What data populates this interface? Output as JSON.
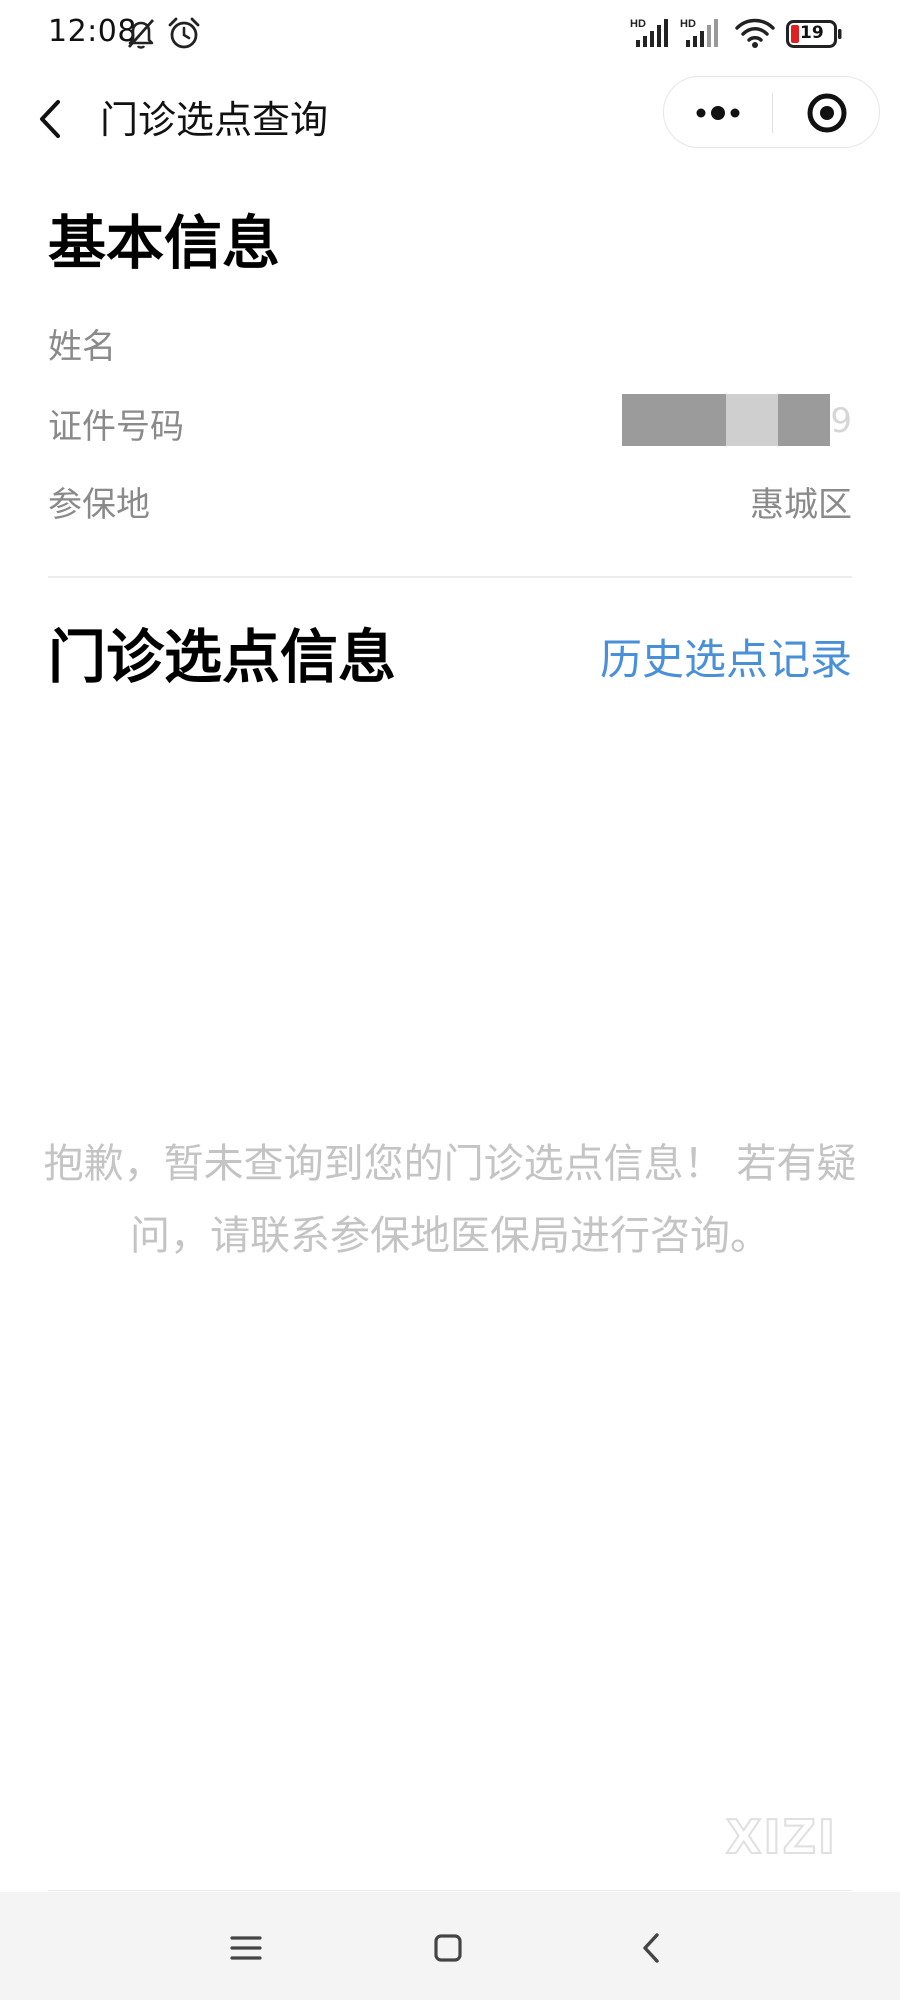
{
  "status_bar": {
    "time": "12:08",
    "battery": "19",
    "signal_1_label": "HD",
    "signal_2_label": "HD",
    "icons": [
      "mute-bell-icon",
      "alarm-icon",
      "signal-icon",
      "signal-icon",
      "wifi-icon",
      "battery-icon"
    ]
  },
  "nav": {
    "title": "门诊选点查询",
    "back_icon": "chevron-left-icon",
    "capsule_more_icon": "more-dots-icon",
    "capsule_close_icon": "target-close-icon"
  },
  "basic_info": {
    "title": "基本信息",
    "name_label": "姓名",
    "name_value": "",
    "id_label": "证件号码",
    "id_value_suffix": "9",
    "region_label": "参保地",
    "region_value": "惠城区"
  },
  "clinic_info": {
    "title": "门诊选点信息",
    "history_link": "历史选点记录",
    "empty_message": "抱歉，暂未查询到您的门诊选点信息！ 若有疑问，请联系参保地医保局进行咨询。"
  },
  "watermark": "XIZI",
  "system_nav": {
    "menu_icon": "menu-lines-icon",
    "home_icon": "square-home-icon",
    "back_icon": "chevron-left-icon"
  },
  "colors": {
    "accent": "#4a90d9",
    "label_gray": "#8a8a8a",
    "message_gray": "#c4c4c4",
    "battery_low": "#e02020"
  }
}
